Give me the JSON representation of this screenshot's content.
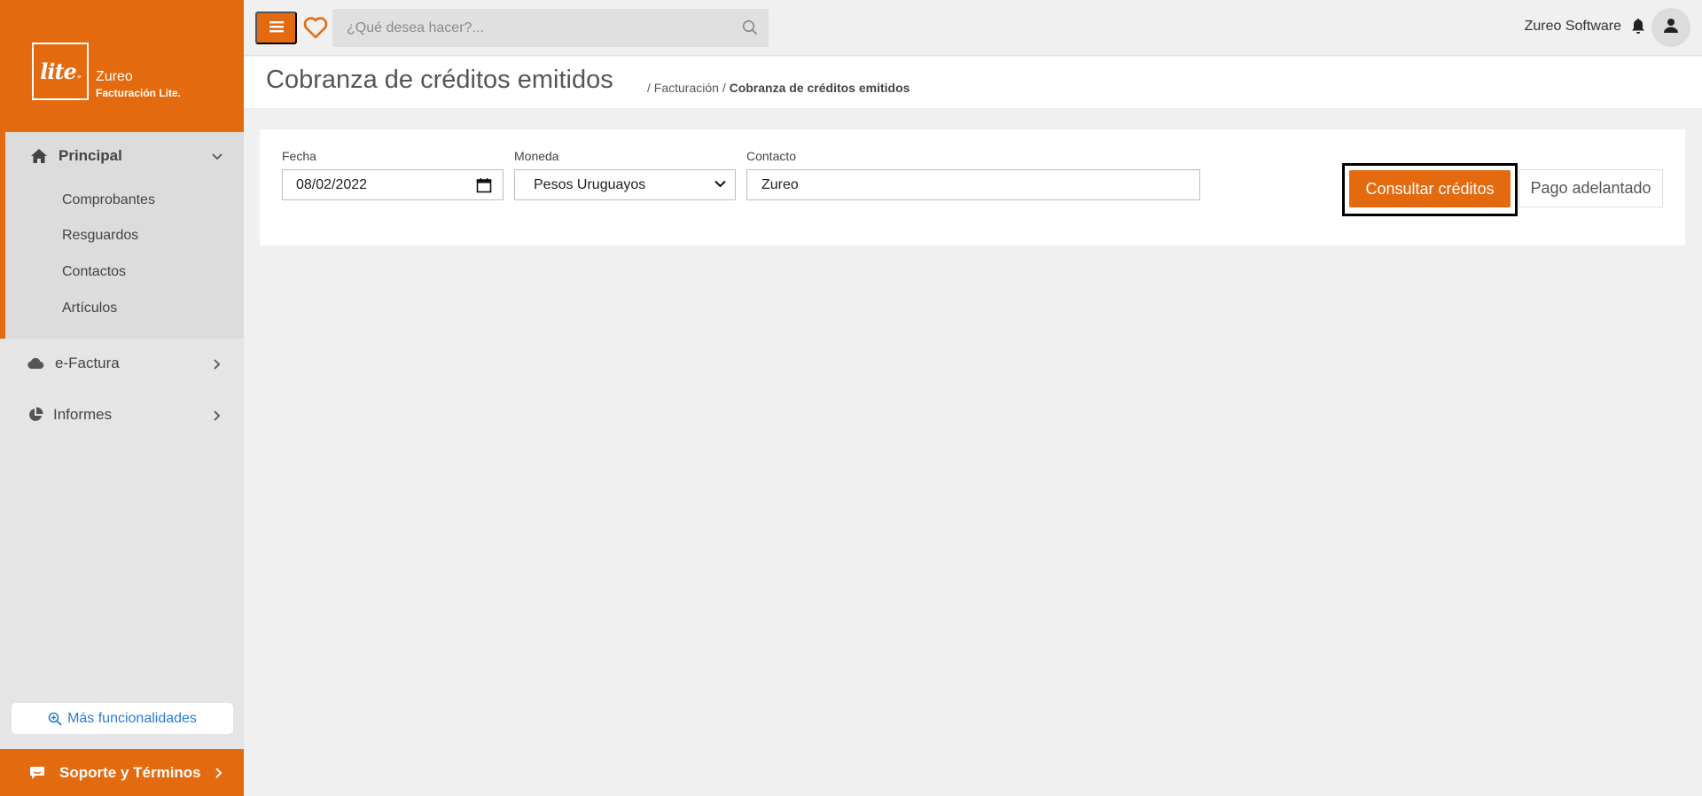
{
  "brand": {
    "logo_text": "lite",
    "logo_mark": "»",
    "name": "Zureo",
    "subtitle": "Facturación Lite."
  },
  "sidebar": {
    "principal": {
      "label": "Principal",
      "icon": "home-icon",
      "expanded": true,
      "items": [
        {
          "label": "Comprobantes"
        },
        {
          "label": "Resguardos"
        },
        {
          "label": "Contactos"
        },
        {
          "label": "Artículos"
        }
      ]
    },
    "efactura": {
      "label": "e-Factura",
      "icon": "cloud-icon"
    },
    "informes": {
      "label": "Informes",
      "icon": "pie-chart-icon"
    },
    "more_button": "Más funcionalidades",
    "support": "Soporte y Términos"
  },
  "topbar": {
    "search_placeholder": "¿Qué desea hacer?...",
    "user_name": "Zureo Software"
  },
  "page": {
    "title": "Cobranza de créditos emitidos",
    "breadcrumb_prefix": "/ Facturación /",
    "breadcrumb_current": "Cobranza de créditos emitidos"
  },
  "form": {
    "fecha_label": "Fecha",
    "fecha_value": "08/02/2022",
    "moneda_label": "Moneda",
    "moneda_value": "Pesos Uruguayos",
    "contacto_label": "Contacto",
    "contacto_value": "Zureo",
    "consult_button": "Consultar créditos",
    "pago_button": "Pago adelantado"
  },
  "colors": {
    "accent": "#e36a0e",
    "link": "#2a7bd3",
    "sidebar_bg": "#e5e5e5"
  }
}
